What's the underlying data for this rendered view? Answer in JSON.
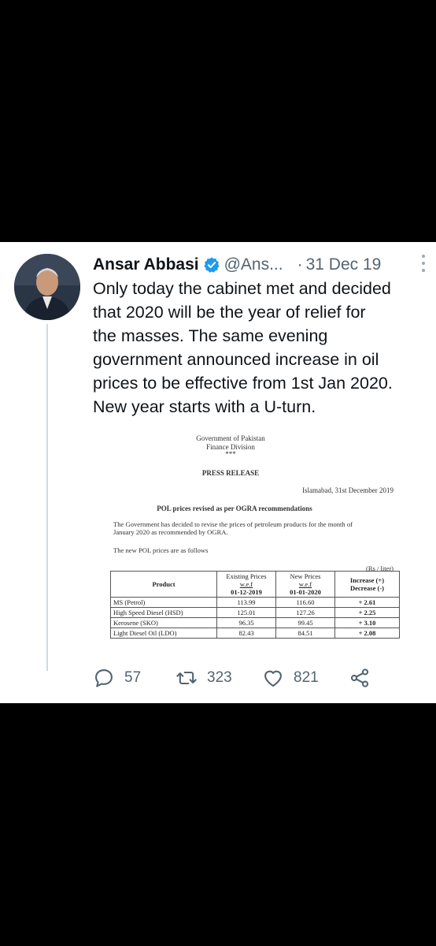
{
  "tweet": {
    "author_name": "Ansar Abbasi",
    "handle": "@Ans...",
    "separator": "·",
    "date": "31 Dec 19",
    "text_lines": [
      "Only today the cabinet met and decided",
      "that 2020 will be the year of relief for",
      "the masses. The same evening",
      "government announced increase in oil",
      "prices to be effective from 1st Jan 2020.",
      "New year starts with a U-turn."
    ]
  },
  "document": {
    "org_line1": "Government of Pakistan",
    "org_line2": "Finance Division",
    "stars": "***",
    "heading": "PRESS RELEASE",
    "place_date": "Islamabad, 31st December 2019",
    "subject": "POL prices revised as per OGRA recommendations",
    "body_line1": "The Government has decided to revise the prices of petroleum products for the month of",
    "body_line2": "January 2020 as recommended by OGRA.",
    "intro": "The new POL prices are as follows",
    "unit": "(Rs / liter)",
    "columns": {
      "product": "Product",
      "existing": "Existing Prices",
      "existing_wef": "w.e.f",
      "existing_date": "01-12-2019",
      "new": "New Prices",
      "new_wef": "w.e.f",
      "new_date": "01-01-2020",
      "increase": "Increase (+)",
      "decrease": "Decrease (-)"
    },
    "rows": [
      {
        "product": "MS (Petrol)",
        "existing": "113.99",
        "new": "116.60",
        "change": "+ 2.61"
      },
      {
        "product": "High Speed Diesel (HSD)",
        "existing": "125.01",
        "new": "127.26",
        "change": "+ 2.25"
      },
      {
        "product": "Kerosene (SKO)",
        "existing": "96.35",
        "new": "99.45",
        "change": "+ 3.10"
      },
      {
        "product": "Light Diesel Oil (LDO)",
        "existing": "82.43",
        "new": "84.51",
        "change": "+ 2.08"
      }
    ]
  },
  "actions": {
    "replies": "57",
    "retweets": "323",
    "likes": "821"
  },
  "icons": {
    "verified": "verified-badge-icon",
    "reply": "reply-icon",
    "retweet": "retweet-icon",
    "like": "heart-icon",
    "share": "share-icon",
    "more": "more-icon"
  },
  "colors": {
    "verified": "#1d9bf0",
    "secondary_text": "#536471",
    "primary_text": "#0f1419"
  }
}
